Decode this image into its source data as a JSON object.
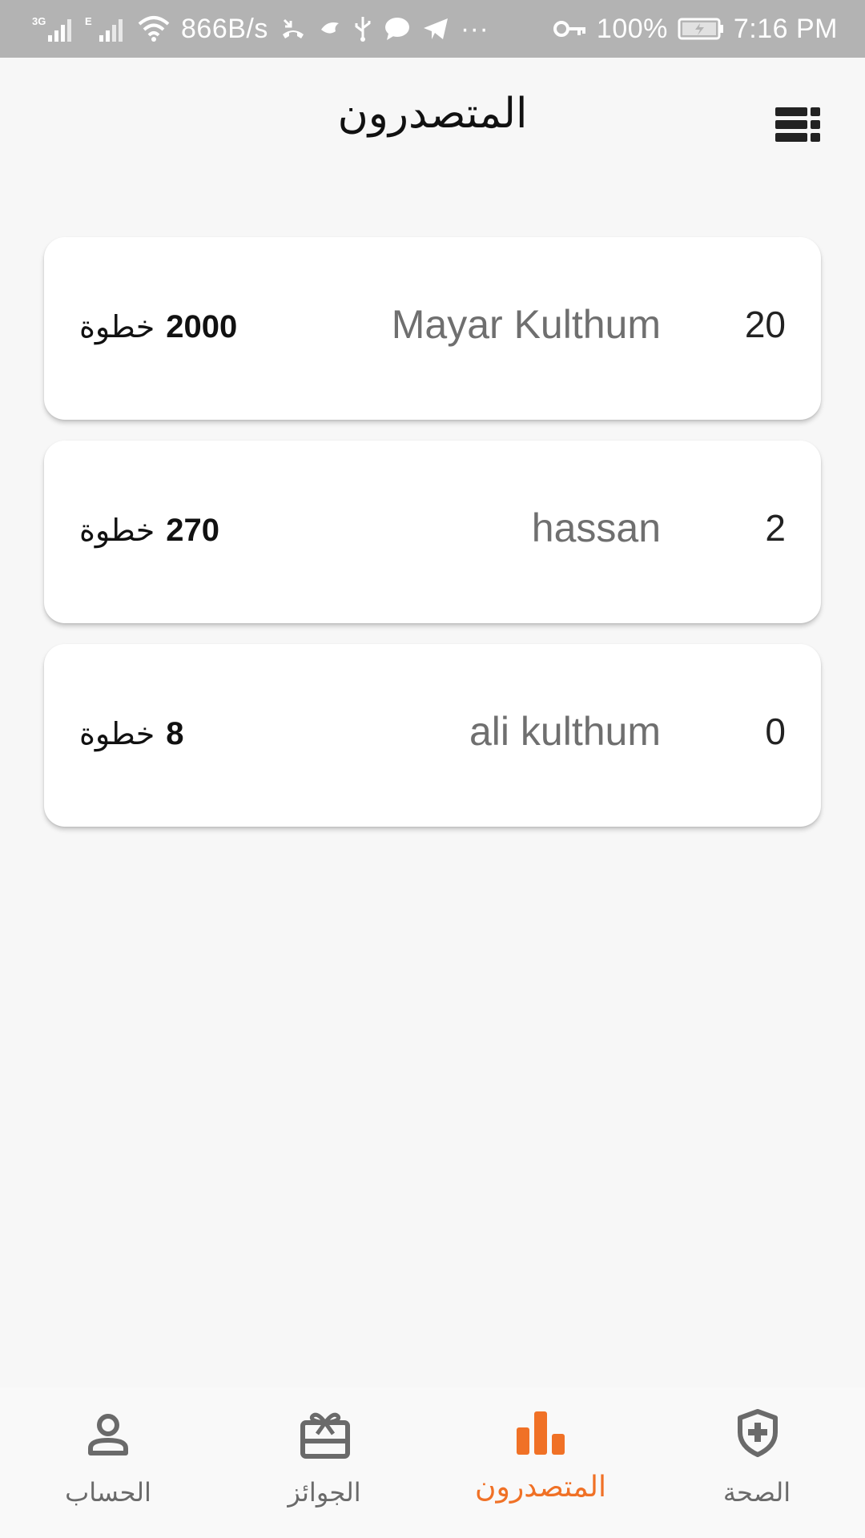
{
  "status_bar": {
    "network_3g": "3G",
    "network_e": "E",
    "speed": "866B/s",
    "more": "···",
    "battery": "100%",
    "time": "7:16 PM"
  },
  "header": {
    "title": "المتصدرون",
    "menu_icon": "view-list-icon"
  },
  "leaderboard": [
    {
      "rank": "20",
      "name": "Mayar Kulthum",
      "steps": "2000",
      "unit": "خطوة"
    },
    {
      "rank": "2",
      "name": "hassan",
      "steps": "270",
      "unit": "خطوة"
    },
    {
      "rank": "0",
      "name": "ali kulthum",
      "steps": "8",
      "unit": "خطوة"
    }
  ],
  "bottom_nav": {
    "active_color": "#f07126",
    "items": [
      {
        "label": "الحساب",
        "icon": "person-icon"
      },
      {
        "label": "الجوائز",
        "icon": "gift-card-icon"
      },
      {
        "label": "المتصدرون",
        "icon": "leaderboard-icon",
        "active": true
      },
      {
        "label": "الصحة",
        "icon": "shield-plus-icon"
      }
    ]
  }
}
